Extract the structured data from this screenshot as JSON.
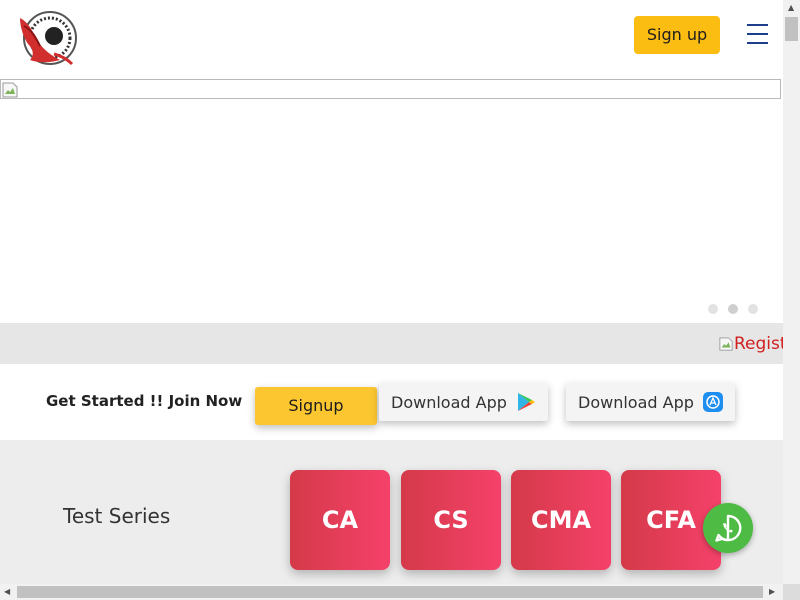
{
  "header": {
    "logo_icon": "eagle-logo-icon",
    "signup_label": "Sign up",
    "menu_icon": "hamburger-menu-icon"
  },
  "banner": {
    "image_icon": "broken-image-icon",
    "carousel": {
      "slides": 3,
      "active_index": 1
    }
  },
  "strip": {
    "alt_text": "Regist"
  },
  "get_started": {
    "text": "Get Started !! Join Now",
    "signup_label": "Signup",
    "download_play_label": "Download App",
    "download_ios_label": "Download App",
    "play_icon": "google-play-icon",
    "ios_icon": "app-store-icon"
  },
  "test_series": {
    "title": "Test Series",
    "cards": [
      "CA",
      "CS",
      "CMA",
      "CFA"
    ]
  },
  "floating": {
    "whatsapp_icon": "whatsapp-icon"
  },
  "colors": {
    "accent_yellow": "#fbbd12",
    "card_gradient_start": "#d43a49",
    "card_gradient_end": "#f5416a",
    "whatsapp_green": "#4dbb44"
  }
}
